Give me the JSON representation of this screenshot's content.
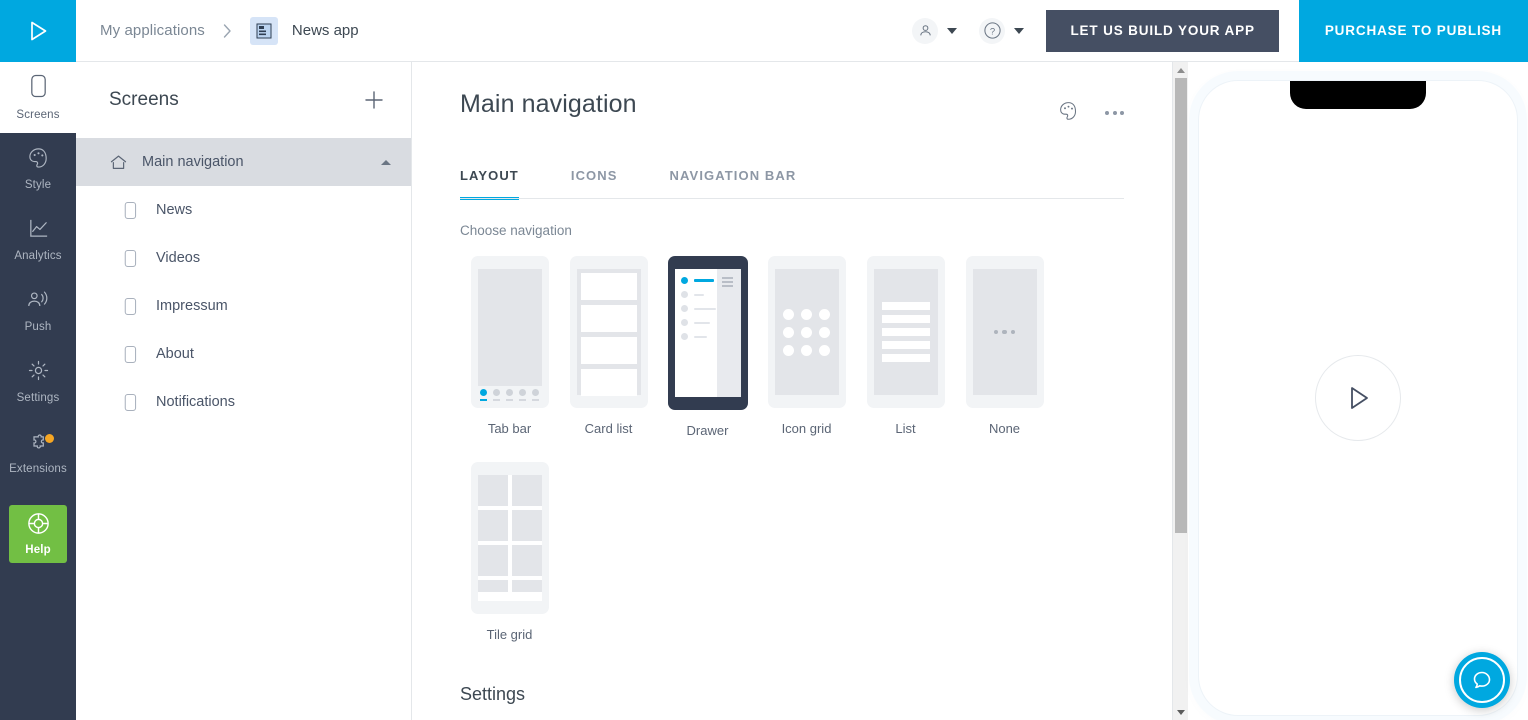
{
  "topbar": {
    "logo_icon": "play-triangle-logo",
    "breadcrumb_root": "My applications",
    "breadcrumb_separator": "›",
    "app_icon": "app-thumbnail-icon",
    "app_name": "News app",
    "account_icon": "user-icon",
    "help_icon": "question-circle-icon",
    "build_button": "LET US BUILD YOUR APP",
    "purchase_button": "PURCHASE TO PUBLISH"
  },
  "rail": {
    "items": [
      {
        "label": "Screens",
        "icon": "phone-outline-icon",
        "active": true,
        "badge": false
      },
      {
        "label": "Style",
        "icon": "palette-icon",
        "active": false,
        "badge": false
      },
      {
        "label": "Analytics",
        "icon": "line-chart-icon",
        "active": false,
        "badge": false
      },
      {
        "label": "Push",
        "icon": "broadcast-person-icon",
        "active": false,
        "badge": false
      },
      {
        "label": "Settings",
        "icon": "gear-icon",
        "active": false,
        "badge": false
      },
      {
        "label": "Extensions",
        "icon": "puzzle-piece-icon",
        "active": false,
        "badge": true
      }
    ],
    "help": {
      "label": "Help",
      "icon": "lifebuoy-icon"
    }
  },
  "screens_panel": {
    "title": "Screens",
    "add_icon": "plus-icon",
    "root": {
      "label": "Main navigation",
      "icon": "home-icon",
      "collapse_icon": "chevron-up-icon",
      "selected": true
    },
    "children": [
      {
        "label": "News",
        "icon": "screen-icon"
      },
      {
        "label": "Videos",
        "icon": "screen-icon"
      },
      {
        "label": "Impressum",
        "icon": "screen-icon"
      },
      {
        "label": "About",
        "icon": "screen-icon"
      },
      {
        "label": "Notifications",
        "icon": "screen-icon"
      }
    ]
  },
  "main": {
    "title": "Main navigation",
    "palette_icon": "palette-icon",
    "more_icon": "more-horizontal-icon",
    "tabs": [
      {
        "label": "LAYOUT",
        "active": true
      },
      {
        "label": "ICONS",
        "active": false
      },
      {
        "label": "NAVIGATION BAR",
        "active": false
      }
    ],
    "choose_label": "Choose navigation",
    "options": [
      {
        "label": "Tab bar",
        "type": "tabbar",
        "selected": false
      },
      {
        "label": "Card list",
        "type": "cardlist",
        "selected": false
      },
      {
        "label": "Drawer",
        "type": "drawer",
        "selected": true
      },
      {
        "label": "Icon grid",
        "type": "icongrid",
        "selected": false
      },
      {
        "label": "List",
        "type": "list",
        "selected": false
      },
      {
        "label": "None",
        "type": "none",
        "selected": false
      },
      {
        "label": "Tile grid",
        "type": "tilegrid",
        "selected": false
      }
    ],
    "settings_heading": "Settings"
  },
  "scrollbar": {
    "up_icon": "triangle-up-icon",
    "down_icon": "triangle-down-icon"
  },
  "preview": {
    "play_icon": "play-icon",
    "device_frame": "phone-notch-frame"
  },
  "beacon": {
    "icon": "chat-bubble-icon"
  },
  "colors": {
    "brand_blue": "#00a8e0",
    "dark_navy": "#323c50",
    "button_dark": "#454f63",
    "help_green": "#72bf44",
    "badge_orange": "#f6a623",
    "selected_row": "#d9dce1"
  }
}
